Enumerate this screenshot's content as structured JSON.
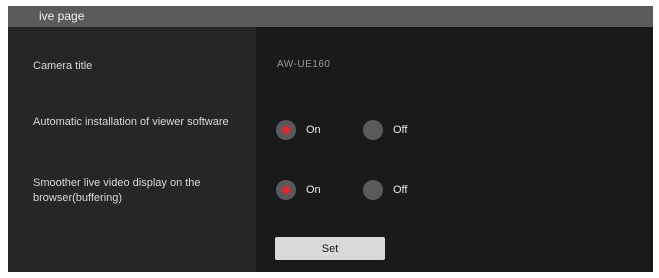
{
  "page": {
    "title": "ive page"
  },
  "settings": {
    "camera_title": {
      "label": "Camera title",
      "value": "AW-UE160"
    },
    "auto_install": {
      "label": "Automatic installation of viewer software",
      "options": [
        {
          "label": "On",
          "selected": true
        },
        {
          "label": "Off",
          "selected": false
        }
      ]
    },
    "smoother_live": {
      "label": "Smoother live video display on the browser(buffering)",
      "options": [
        {
          "label": "On",
          "selected": true
        },
        {
          "label": "Off",
          "selected": false
        }
      ]
    }
  },
  "actions": {
    "set_label": "Set"
  },
  "colors": {
    "titlebar": "#5b5b5b",
    "panel": "#1f1f1f",
    "radio_selected": "#e4262c",
    "button": "#d9d9d9"
  }
}
